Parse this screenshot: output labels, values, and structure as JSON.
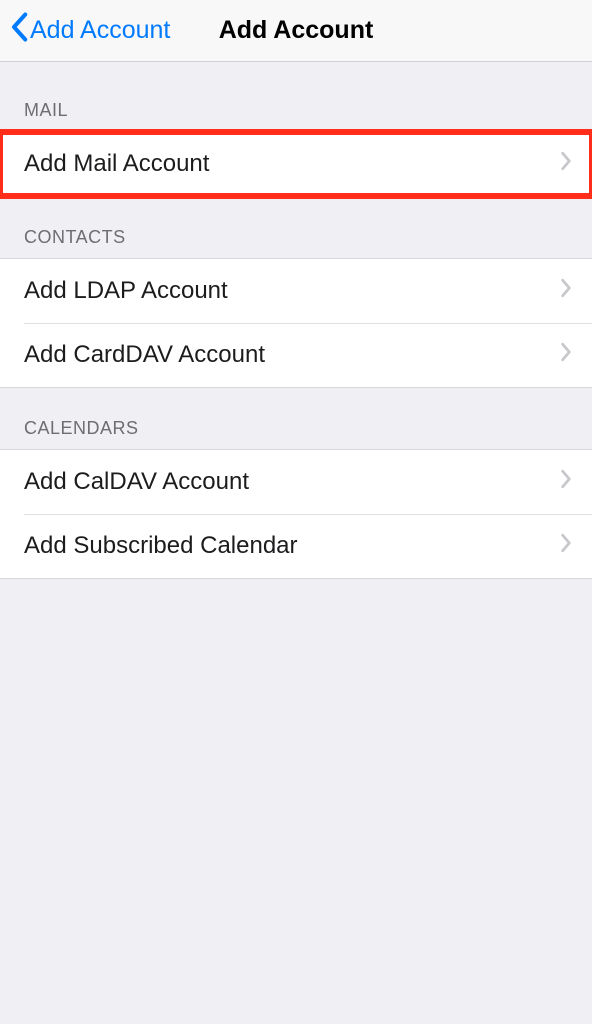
{
  "nav": {
    "back_label": "Add Account",
    "title": "Add Account"
  },
  "sections": {
    "mail": {
      "header": "MAIL",
      "items": {
        "addMail": "Add Mail Account"
      }
    },
    "contacts": {
      "header": "CONTACTS",
      "items": {
        "ldap": "Add LDAP Account",
        "carddav": "Add CardDAV Account"
      }
    },
    "calendars": {
      "header": "CALENDARS",
      "items": {
        "caldav": "Add CalDAV Account",
        "subscribed": "Add Subscribed Calendar"
      }
    }
  }
}
